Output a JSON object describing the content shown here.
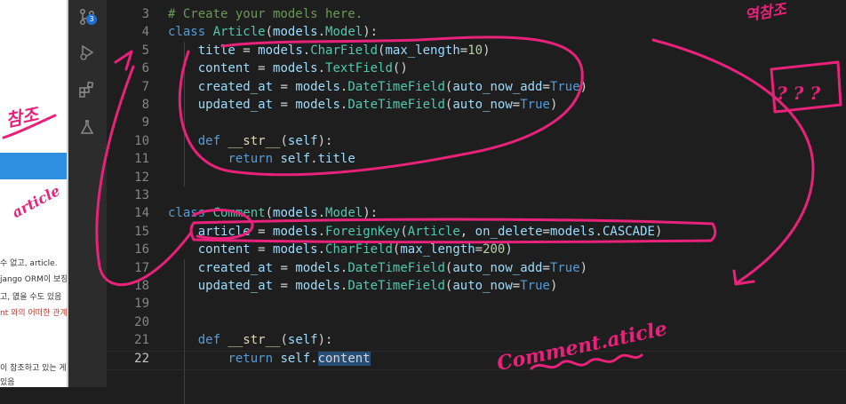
{
  "left_panel": {
    "snippets": [
      {
        "text": "수 없고, article.",
        "red": false
      },
      {
        "text": "jango ORM이 보장한",
        "red": false
      },
      {
        "text": "고, 엾을 수도 있음",
        "red": false
      },
      {
        "text": "nt 와의 어떠한 관계도",
        "red": true
      },
      {
        "text": "이 참조하고 있는 게시",
        "red": false
      },
      {
        "text": "있음",
        "red": false
      }
    ]
  },
  "activity_bar": {
    "source_control_badge": "3",
    "icons": [
      "source-control-icon",
      "run-debug-icon",
      "extensions-icon",
      "testing-icon"
    ]
  },
  "editor": {
    "lines": [
      {
        "n": "3",
        "tokens": [
          [
            "cmt",
            "# Create your models here."
          ]
        ]
      },
      {
        "n": "4",
        "tokens": [
          [
            "kw",
            "class "
          ],
          [
            "cls",
            "Article"
          ],
          [
            "op",
            "("
          ],
          [
            "var",
            "models"
          ],
          [
            "op",
            "."
          ],
          [
            "cls",
            "Model"
          ],
          [
            "op",
            "):"
          ]
        ]
      },
      {
        "n": "5",
        "tokens": [
          [
            "op",
            "    "
          ],
          [
            "var",
            "title"
          ],
          [
            "op",
            " = "
          ],
          [
            "var",
            "models"
          ],
          [
            "op",
            "."
          ],
          [
            "cls",
            "CharField"
          ],
          [
            "op",
            "("
          ],
          [
            "var",
            "max_length"
          ],
          [
            "op",
            "="
          ],
          [
            "num",
            "10"
          ],
          [
            "op",
            ")"
          ]
        ]
      },
      {
        "n": "6",
        "tokens": [
          [
            "op",
            "    "
          ],
          [
            "var",
            "content"
          ],
          [
            "op",
            " = "
          ],
          [
            "var",
            "models"
          ],
          [
            "op",
            "."
          ],
          [
            "cls",
            "TextField"
          ],
          [
            "op",
            "()"
          ]
        ]
      },
      {
        "n": "7",
        "tokens": [
          [
            "op",
            "    "
          ],
          [
            "var",
            "created_at"
          ],
          [
            "op",
            " = "
          ],
          [
            "var",
            "models"
          ],
          [
            "op",
            "."
          ],
          [
            "cls",
            "DateTimeField"
          ],
          [
            "op",
            "("
          ],
          [
            "var",
            "auto_now_add"
          ],
          [
            "op",
            "="
          ],
          [
            "kw",
            "True"
          ],
          [
            "op",
            ")"
          ]
        ]
      },
      {
        "n": "8",
        "tokens": [
          [
            "op",
            "    "
          ],
          [
            "var",
            "updated_at"
          ],
          [
            "op",
            " = "
          ],
          [
            "var",
            "models"
          ],
          [
            "op",
            "."
          ],
          [
            "cls",
            "DateTimeField"
          ],
          [
            "op",
            "("
          ],
          [
            "var",
            "auto_now"
          ],
          [
            "op",
            "="
          ],
          [
            "kw",
            "True"
          ],
          [
            "op",
            ")"
          ]
        ]
      },
      {
        "n": "9",
        "tokens": []
      },
      {
        "n": "10",
        "tokens": [
          [
            "op",
            "    "
          ],
          [
            "kw",
            "def "
          ],
          [
            "fn",
            "__str__"
          ],
          [
            "op",
            "("
          ],
          [
            "var",
            "self"
          ],
          [
            "op",
            "):"
          ]
        ]
      },
      {
        "n": "11",
        "tokens": [
          [
            "op",
            "        "
          ],
          [
            "kw",
            "return "
          ],
          [
            "var",
            "self"
          ],
          [
            "op",
            "."
          ],
          [
            "var",
            "title"
          ]
        ]
      },
      {
        "n": "12",
        "tokens": []
      },
      {
        "n": "13",
        "tokens": []
      },
      {
        "n": "14",
        "tokens": [
          [
            "kw",
            "class "
          ],
          [
            "cls",
            "Comment"
          ],
          [
            "op",
            "("
          ],
          [
            "var",
            "models"
          ],
          [
            "op",
            "."
          ],
          [
            "cls",
            "Model"
          ],
          [
            "op",
            "):"
          ]
        ]
      },
      {
        "n": "15",
        "tokens": [
          [
            "op",
            "    "
          ],
          [
            "var",
            "article"
          ],
          [
            "op",
            " = "
          ],
          [
            "var",
            "models"
          ],
          [
            "op",
            "."
          ],
          [
            "cls",
            "ForeignKey"
          ],
          [
            "op",
            "("
          ],
          [
            "cls",
            "Article"
          ],
          [
            "op",
            ", "
          ],
          [
            "var",
            "on_delete"
          ],
          [
            "op",
            "="
          ],
          [
            "var",
            "models"
          ],
          [
            "op",
            "."
          ],
          [
            "var",
            "CASCADE"
          ],
          [
            "op",
            ")"
          ]
        ]
      },
      {
        "n": "16",
        "tokens": [
          [
            "op",
            "    "
          ],
          [
            "var",
            "content"
          ],
          [
            "op",
            " = "
          ],
          [
            "var",
            "models"
          ],
          [
            "op",
            "."
          ],
          [
            "cls",
            "CharField"
          ],
          [
            "op",
            "("
          ],
          [
            "var",
            "max_length"
          ],
          [
            "op",
            "="
          ],
          [
            "num",
            "200"
          ],
          [
            "op",
            ")"
          ]
        ]
      },
      {
        "n": "17",
        "tokens": [
          [
            "op",
            "    "
          ],
          [
            "var",
            "created_at"
          ],
          [
            "op",
            " = "
          ],
          [
            "var",
            "models"
          ],
          [
            "op",
            "."
          ],
          [
            "cls",
            "DateTimeField"
          ],
          [
            "op",
            "("
          ],
          [
            "var",
            "auto_now_add"
          ],
          [
            "op",
            "="
          ],
          [
            "kw",
            "True"
          ],
          [
            "op",
            ")"
          ]
        ]
      },
      {
        "n": "18",
        "tokens": [
          [
            "op",
            "    "
          ],
          [
            "var",
            "updated_at"
          ],
          [
            "op",
            " = "
          ],
          [
            "var",
            "models"
          ],
          [
            "op",
            "."
          ],
          [
            "cls",
            "DateTimeField"
          ],
          [
            "op",
            "("
          ],
          [
            "var",
            "auto_now"
          ],
          [
            "op",
            "="
          ],
          [
            "kw",
            "True"
          ],
          [
            "op",
            ")"
          ]
        ]
      },
      {
        "n": "19",
        "tokens": []
      },
      {
        "n": "20",
        "tokens": []
      },
      {
        "n": "21",
        "tokens": [
          [
            "op",
            "    "
          ],
          [
            "kw",
            "def "
          ],
          [
            "fn",
            "__str__"
          ],
          [
            "op",
            "("
          ],
          [
            "var",
            "self"
          ],
          [
            "op",
            "):"
          ]
        ]
      },
      {
        "n": "22",
        "tokens": [
          [
            "op",
            "        "
          ],
          [
            "kw",
            "return "
          ],
          [
            "var",
            "self"
          ],
          [
            "op",
            "."
          ],
          [
            "sel",
            "content"
          ]
        ]
      }
    ],
    "active_line": "22"
  },
  "annotations": {
    "color": "#e8227a",
    "handwritten": [
      "Comment.aticle",
      "article",
      "참조",
      "역참조",
      "? ? ?"
    ]
  }
}
